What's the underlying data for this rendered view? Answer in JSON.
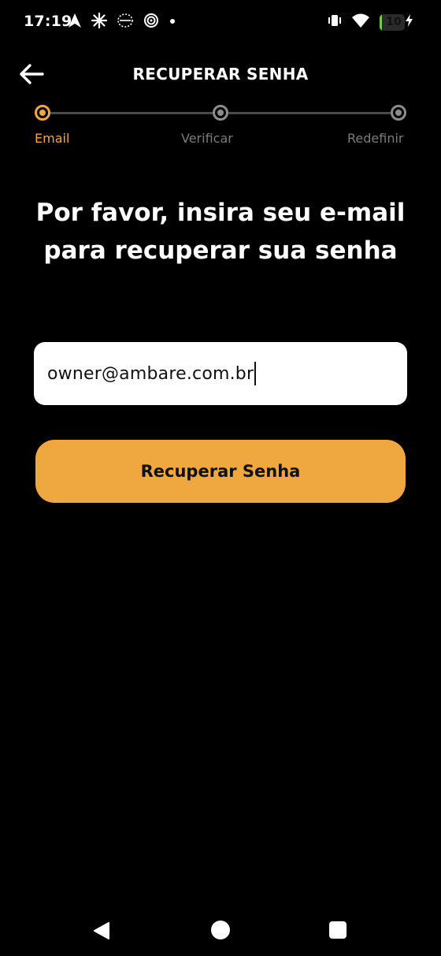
{
  "status_bar": {
    "time": "17:19",
    "battery_level": "10",
    "battery_fraction": 0.1,
    "icons": [
      "navigation-arrow-icon",
      "sparkle-icon",
      "satellite-icon",
      "hotspot-icon",
      "notification-dot-icon",
      "vibrate-icon",
      "wifi-icon",
      "battery-icon",
      "charging-bolt-icon"
    ]
  },
  "header": {
    "back_icon": "arrow-left-icon",
    "title": "RECUPERAR SENHA"
  },
  "stepper": {
    "steps": [
      {
        "label": "Email",
        "active": true
      },
      {
        "label": "Verificar",
        "active": false
      },
      {
        "label": "Redefinir",
        "active": false
      }
    ]
  },
  "form": {
    "heading": "Por favor, insira seu e-mail para recuperar sua senha",
    "email_value": "owner@ambare.com.br",
    "submit_label": "Recuperar Senha"
  },
  "colors": {
    "accent": "#efa73f",
    "background": "#000000",
    "inactive": "#8c8c8c"
  },
  "nav_bar": {
    "icons": [
      "nav-back-icon",
      "nav-home-icon",
      "nav-recents-icon"
    ]
  }
}
